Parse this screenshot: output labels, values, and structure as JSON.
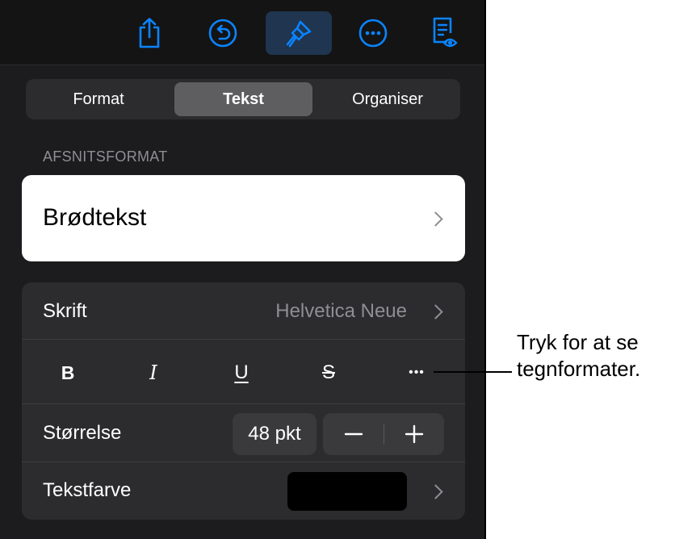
{
  "toolbar": {
    "icons": [
      "share-icon",
      "undo-icon",
      "paintbrush-icon",
      "more-icon",
      "reading-view-icon"
    ],
    "accent_color": "#0a84ff",
    "active": "paintbrush-icon"
  },
  "tabs": [
    {
      "label": "Format"
    },
    {
      "label": "Tekst",
      "selected": true
    },
    {
      "label": "Organiser"
    }
  ],
  "paragraph_style": {
    "section_title": "AFSNITSFORMAT",
    "value": "Brødtekst"
  },
  "font": {
    "label": "Skrift",
    "value": "Helvetica Neue"
  },
  "text_styles": {
    "bold": "B",
    "italic": "I",
    "underline": "U",
    "strikethrough": "S",
    "more": "•••"
  },
  "size": {
    "label": "Størrelse",
    "value": "48 pkt",
    "decrease": "−",
    "increase": "+"
  },
  "color": {
    "label": "Tekstfarve",
    "swatch": "#000000"
  },
  "callout": {
    "line1": "Tryk for at se",
    "line2": "tegnformater."
  }
}
